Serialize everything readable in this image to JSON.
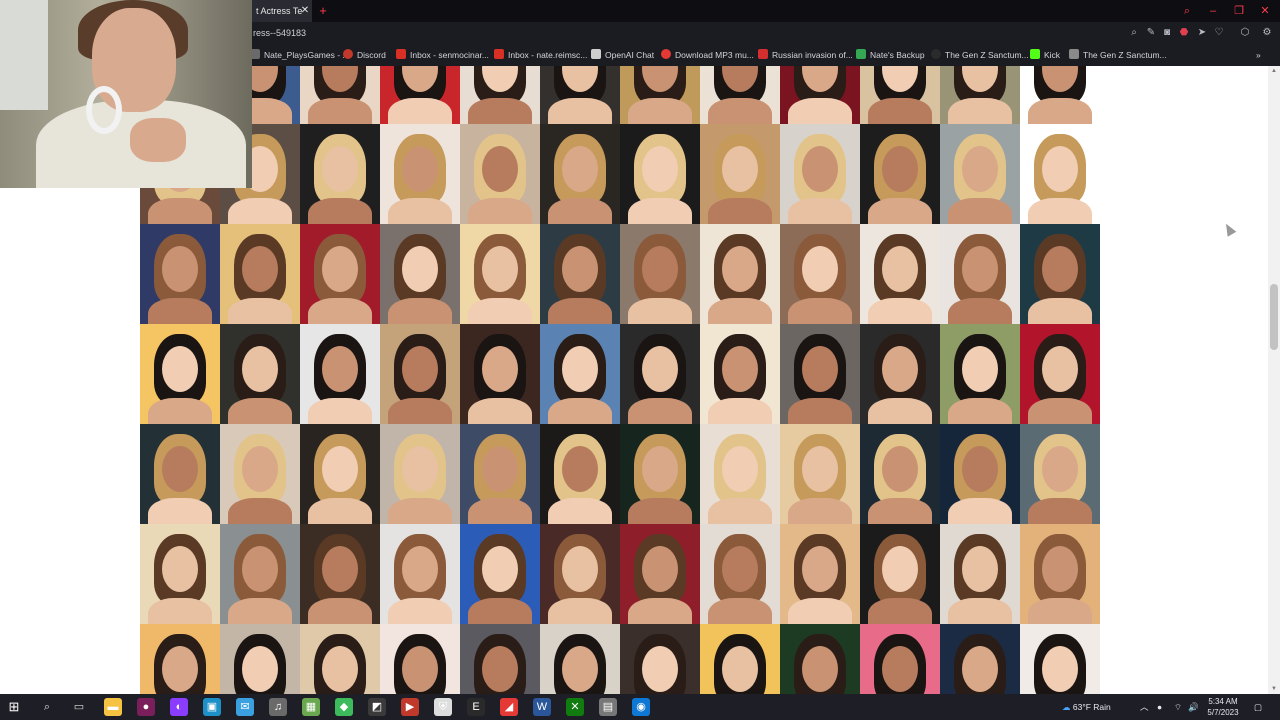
{
  "browser": {
    "tab_title": "t Actress Te",
    "url": "ress--549183",
    "bookmarks": [
      {
        "label": "Nate_PlaysGames - ...",
        "color": "#6a6a6a"
      },
      {
        "label": "Discord",
        "color": "#c0392b"
      },
      {
        "label": "Inbox - senmocinar...",
        "color": "#d93025"
      },
      {
        "label": "Inbox - nate.reimsc...",
        "color": "#d93025"
      },
      {
        "label": "OpenAI Chat",
        "color": "#cfcfcf"
      },
      {
        "label": "Download MP3 mu...",
        "color": "#e53935"
      },
      {
        "label": "Russian invasion of...",
        "color": "#d32f2f"
      },
      {
        "label": "Nate's Backup",
        "color": "#34a853"
      },
      {
        "label": "The Gen Z Sanctum...",
        "color": "#2b2b2b"
      },
      {
        "label": "Kick",
        "color": "#53fc18"
      },
      {
        "label": "The Gen Z Sanctum...",
        "color": "#8a8a8a"
      }
    ]
  },
  "photo_grid": {
    "rows": 7,
    "columns": 12,
    "palette": [
      [
        "#2ba896",
        "#3c5b8f",
        "#e9d6c4",
        "#c9262b",
        "#e7ddd3",
        "#33302e",
        "#c09a5a",
        "#ebe2d5",
        "#7a1420",
        "#d9c2a0",
        "#9a9477",
        "#ffffff"
      ],
      [
        "#6a4a3a",
        "#5c4e44",
        "#1f1f1f",
        "#efe4dc",
        "#c7b39e",
        "#2a2622",
        "#1b1b1b",
        "#c49a6c",
        "#d8d2cc",
        "#1d1d1d",
        "#9aa2a4",
        "#ffffff"
      ],
      [
        "#2f3a66",
        "#e5c07a",
        "#a21b2b",
        "#7a706c",
        "#f0d8a6",
        "#2d3b44",
        "#8b7a6c",
        "#efe5d6",
        "#8c6c56",
        "#ece6de",
        "#e9e4df",
        "#1d3a45"
      ],
      [
        "#f5c463",
        "#30302c",
        "#e6e6e6",
        "#c4a27a",
        "#3c2720",
        "#5a83b4",
        "#2a2a2a",
        "#f1e6d2",
        "#6b6661",
        "#2a2a2a",
        "#8e9c66",
        "#b2152b"
      ],
      [
        "#233035",
        "#d9c9b8",
        "#2a2420",
        "#c1b4a8",
        "#3d4b66",
        "#1c1a18",
        "#16261e",
        "#e8ded4",
        "#e6cba0",
        "#1d2a33",
        "#16263a",
        "#5a6b74"
      ],
      [
        "#ead9b6",
        "#8a8f92",
        "#3c2d24",
        "#e5e3e1",
        "#2b5db8",
        "#4a2a26",
        "#8e1f2a",
        "#e2dcd4",
        "#e3b98a",
        "#1b1b1b",
        "#e0d9d2",
        "#e2b27a"
      ],
      [
        "#f0b96a",
        "#c3b6a6",
        "#e0c9a8",
        "#f2e4df",
        "#5a5a60",
        "#d9d2c8",
        "#3a2f2a",
        "#f2c35a",
        "#1d3a22",
        "#e86b8a",
        "#1c2b44",
        "#f0ebe6"
      ]
    ]
  },
  "taskbar": {
    "weather": "63°F  Rain",
    "time": "5:34 AM",
    "date": "5/7/2023",
    "apps": [
      "file-explorer",
      "record",
      "firefox",
      "photos",
      "mail",
      "headset",
      "minecraft",
      "game",
      "store",
      "video",
      "shield",
      "epic",
      "android",
      "word",
      "xbox",
      "mixer",
      "edge"
    ]
  }
}
